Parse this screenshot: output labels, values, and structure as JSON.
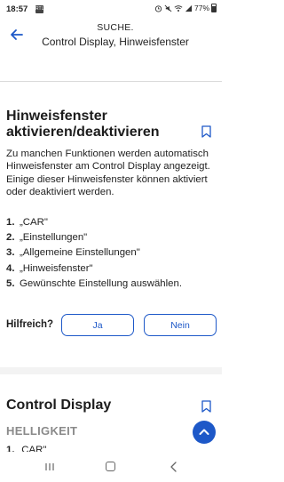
{
  "status_bar": {
    "time": "18:57",
    "app_badge": "RTL",
    "battery": "77%"
  },
  "header": {
    "title": "SUCHE.",
    "subtitle": "Control Display, Hinweisfenster"
  },
  "section1": {
    "title_line1": "Hinweisfenster",
    "title_line2": "aktivieren/deaktivieren",
    "description": "Zu manchen Funktionen werden automatisch Hinweisfenster am Control Display angezeigt. Einige dieser Hinweisfenster können aktiviert oder deaktiviert werden.",
    "steps": [
      {
        "num": "1.",
        "text": "„CAR\""
      },
      {
        "num": "2.",
        "text": "„Einstellungen\""
      },
      {
        "num": "3.",
        "text": "„Allgemeine Einstellungen\""
      },
      {
        "num": "4.",
        "text": "„Hinweisfenster\""
      },
      {
        "num": "5.",
        "text": "Gewünschte Einstellung auswählen."
      }
    ]
  },
  "feedback": {
    "label": "Hilfreich?",
    "yes": "Ja",
    "no": "Nein"
  },
  "section2": {
    "title": "Control Display",
    "subheading": "HELLIGKEIT",
    "first_step_num": "1.",
    "first_step_text": "„CAR\""
  },
  "colors": {
    "accent": "#1d58c8",
    "divider": "#d9d9d9",
    "subheading_gray": "#8a8a8a"
  },
  "icons": [
    "back-arrow-icon",
    "bookmark-icon",
    "chevron-up-icon",
    "wifi-icon",
    "signal-icon",
    "battery-icon",
    "recents-icon",
    "home-icon",
    "nav-back-icon"
  ]
}
